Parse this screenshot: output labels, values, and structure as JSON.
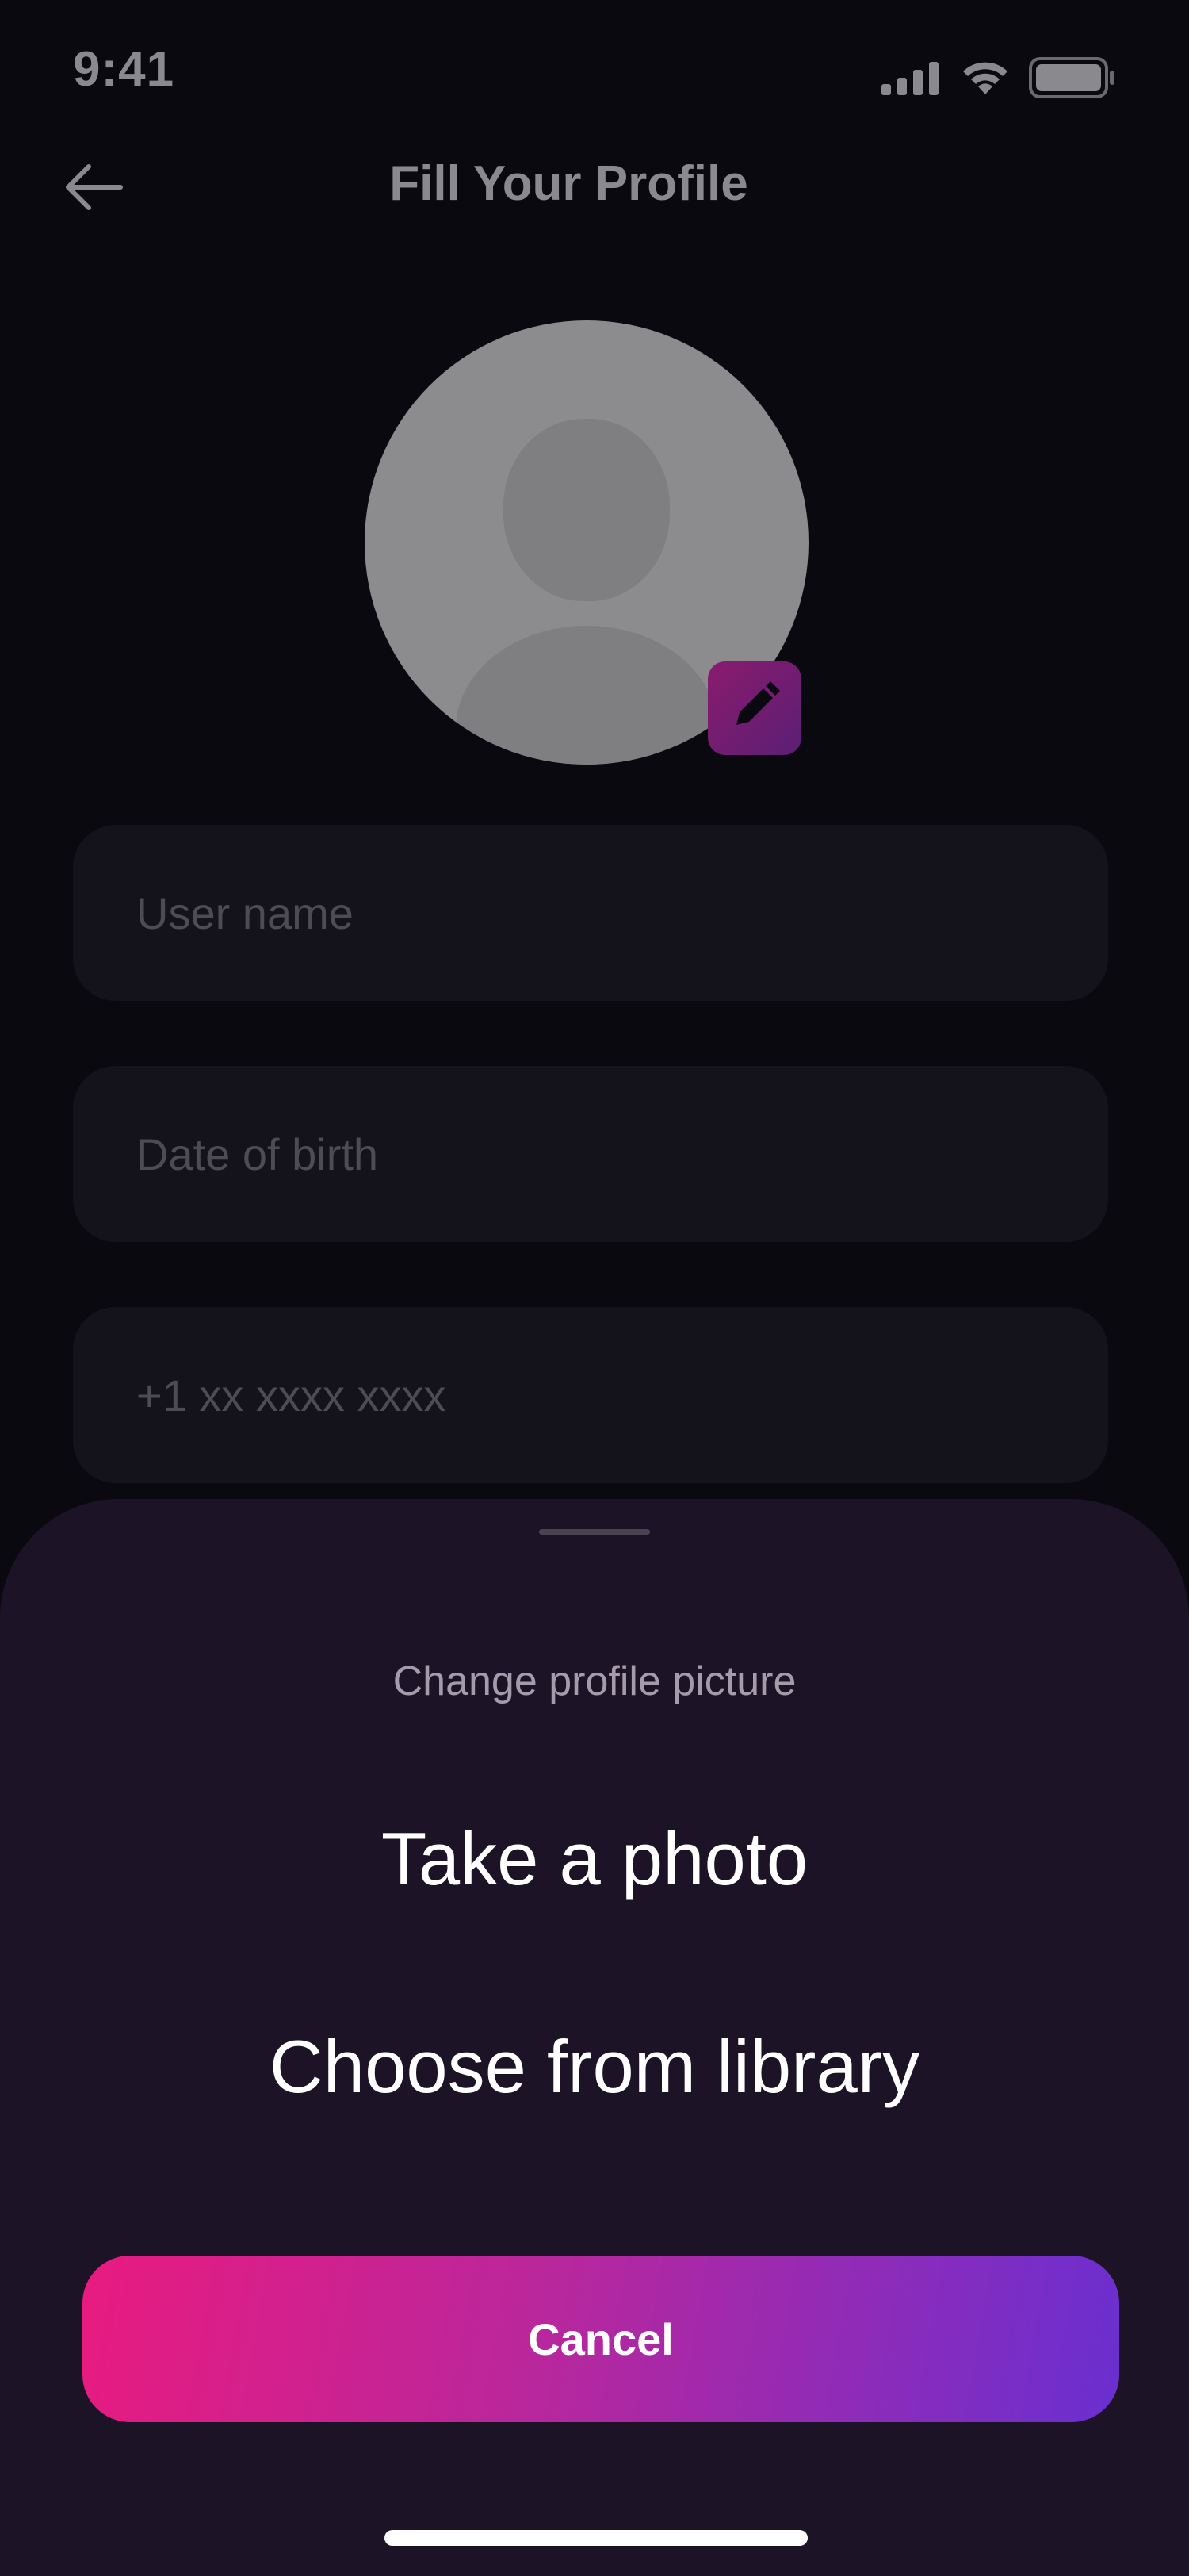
{
  "status_bar": {
    "time": "9:41"
  },
  "header": {
    "title": "Fill Your Profile",
    "back_icon": "arrow-left-icon"
  },
  "profile": {
    "avatar_icon": "person-placeholder-icon",
    "edit_icon": "pencil-icon"
  },
  "form": {
    "username_placeholder": "User name",
    "dob_placeholder": "Date of birth",
    "phone_placeholder": "+1 xx xxxx xxxx"
  },
  "sheet": {
    "title": "Change profile picture",
    "take_photo_label": "Take a photo",
    "choose_library_label": "Choose from library",
    "cancel_label": "Cancel"
  },
  "colors": {
    "background": "#0b0910",
    "sheet": "#1c1326",
    "accent_start": "#e81b80",
    "accent_end": "#6a2fd0"
  }
}
